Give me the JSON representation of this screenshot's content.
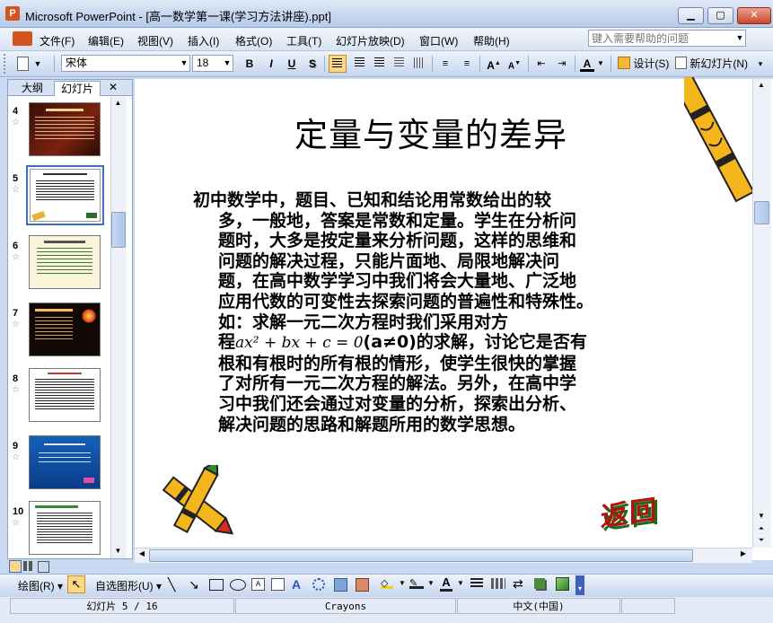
{
  "window": {
    "app_icon_letter": "P",
    "title": "Microsoft PowerPoint - [高一数学第一课(学习方法讲座).ppt]",
    "min": "▁",
    "max": "▢",
    "close": "✕"
  },
  "menu": [
    "文件(F)",
    "编辑(E)",
    "视图(V)",
    "插入(I)",
    "格式(O)",
    "工具(T)",
    "幻灯片放映(D)",
    "窗口(W)",
    "帮助(H)"
  ],
  "help_search": {
    "placeholder": "键入需要帮助的问题"
  },
  "format_toolbar": {
    "font_name": "宋体",
    "font_size": "18",
    "bold": "B",
    "italic": "I",
    "underline": "U",
    "shadow": "S",
    "design_label": "设计(S)",
    "new_slide_label": "新幻灯片(N)"
  },
  "left_pane": {
    "tabs": [
      "大纲",
      "幻灯片"
    ],
    "close": "✕",
    "thumbnails": [
      {
        "number": "4",
        "style": "dark-red"
      },
      {
        "number": "5",
        "style": "white-selected"
      },
      {
        "number": "6",
        "style": "cream"
      },
      {
        "number": "7",
        "style": "dark"
      },
      {
        "number": "8",
        "style": "white"
      },
      {
        "number": "9",
        "style": "blue"
      },
      {
        "number": "10",
        "style": "white-green"
      }
    ],
    "star": "☆"
  },
  "slide": {
    "title": "定量与变量的差异",
    "body_lines": [
      "初中数学中，题目、已知和结论用常数给出的较",
      "多，一般地，答案是常数和定量。学生在分析问",
      "题时，大多是按定量来分析问题，这样的思维和",
      "问题的解决过程，只能片面地、局限地解决问",
      "题，在高中数学学习中我们将会大量地、广泛地",
      "应用代数的可变性去探索问题的普遍性和特殊性。",
      "如：求解一元二次方程时我们采用对方"
    ],
    "equation_prefix": "程",
    "equation": "ax² + bx + c = 0",
    "equation_cond": "(a≠0)",
    "equation_suffix": "的求解，讨论它是否有",
    "body_lines_2": [
      "根和有根时的所有根的情形，使学生很快的掌握",
      "了对所有一元二次方程的解法。另外，在高中学",
      "习中我们还会通过对变量的分析，探索出分析、",
      "解决问题的思路和解题所用的数学思想。"
    ],
    "return_button": "返回"
  },
  "draw_toolbar": {
    "draw_label": "绘图(R)",
    "autoshape_label": "自选图形(U)"
  },
  "status": {
    "slide_info": "幻灯片 5 / 16",
    "design": "Crayons",
    "language": "中文(中国)"
  },
  "colors": {
    "accent_selected": "#fbd887",
    "selection_blue": "#3a6ec7"
  }
}
